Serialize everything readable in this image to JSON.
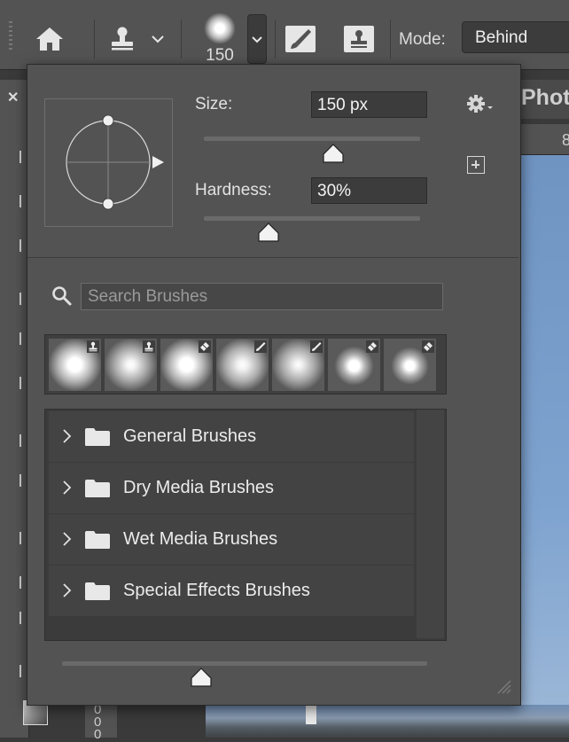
{
  "options_bar": {
    "brush_size": "150",
    "mode_label": "Mode:",
    "mode_value": "Behind"
  },
  "document": {
    "tab_title": "Phot",
    "ruler_top_label": "8",
    "ruler_left_label": "0 0 0"
  },
  "brush_popup": {
    "size_label": "Size:",
    "size_value": "150 px",
    "size_level": 0.6,
    "hardness_label": "Hardness:",
    "hardness_value": "30%",
    "hardness_level": 0.3,
    "search_placeholder": "Search Brushes",
    "preview_size_level": 0.38,
    "recent_presets": [
      {
        "tool": "stamp-icon"
      },
      {
        "tool": "stamp-icon"
      },
      {
        "tool": "eraser-icon"
      },
      {
        "tool": "brush-icon"
      },
      {
        "tool": "brush-icon"
      },
      {
        "tool": "eraser-icon"
      },
      {
        "tool": "eraser-icon"
      }
    ],
    "folders": [
      {
        "label": "General Brushes"
      },
      {
        "label": "Dry Media Brushes"
      },
      {
        "label": "Wet Media Brushes"
      },
      {
        "label": "Special Effects Brushes"
      }
    ]
  },
  "colors": {
    "panel": "#535353",
    "field": "#3c3c3c",
    "canvas_sky": "#7ea3cf"
  }
}
